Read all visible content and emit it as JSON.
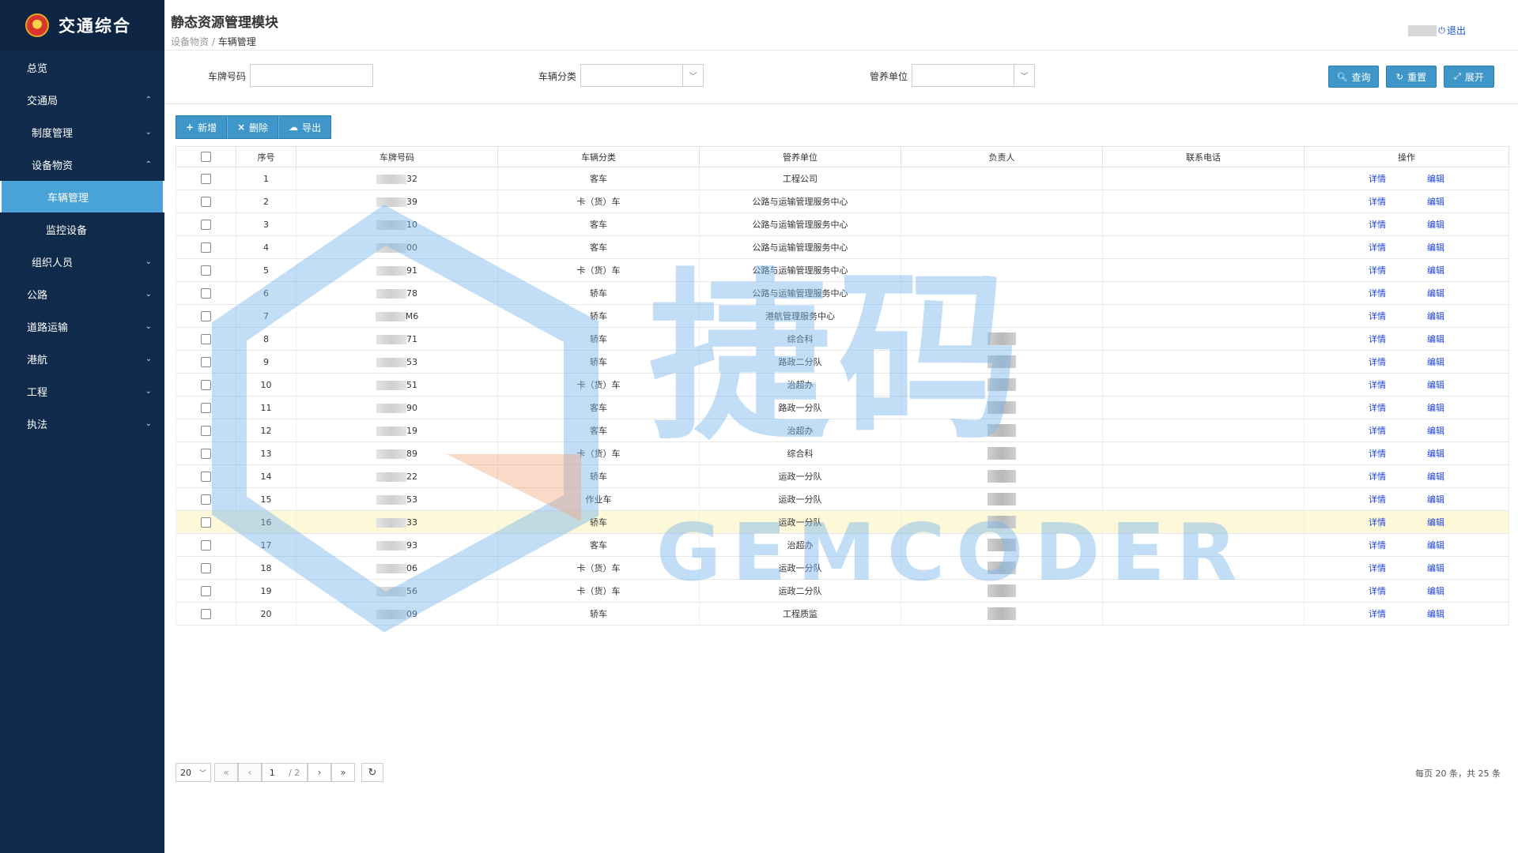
{
  "app": {
    "brand": "交通综合"
  },
  "sidebar": {
    "items": [
      {
        "label": "总览",
        "chevron": ""
      },
      {
        "label": "交通局",
        "chevron": "⌃"
      },
      {
        "label": "制度管理",
        "chevron": "⌄"
      },
      {
        "label": "设备物资",
        "chevron": "⌃"
      },
      {
        "label": "车辆管理",
        "chevron": ""
      },
      {
        "label": "监控设备",
        "chevron": ""
      },
      {
        "label": "组织人员",
        "chevron": "⌄"
      },
      {
        "label": "公路",
        "chevron": "⌄"
      },
      {
        "label": "道路运输",
        "chevron": "⌄"
      },
      {
        "label": "港航",
        "chevron": "⌄"
      },
      {
        "label": "工程",
        "chevron": "⌄"
      },
      {
        "label": "执法",
        "chevron": "⌄"
      }
    ]
  },
  "header": {
    "title": "静态资源管理模块",
    "breadcrumb_parent": "设备物资",
    "breadcrumb_sep": "/",
    "breadcrumb_current": "车辆管理",
    "logout": "退出"
  },
  "filters": {
    "plate_label": "车牌号码",
    "plate_value": "",
    "category_label": "车辆分类",
    "category_value": "",
    "unit_label": "管养单位",
    "unit_value": "",
    "query": "查询",
    "reset": "重置",
    "expand": "展开"
  },
  "toolbar": {
    "add": "新增",
    "delete": "删除",
    "export": "导出"
  },
  "table": {
    "headers": [
      "序号",
      "车牌号码",
      "车辆分类",
      "管养单位",
      "负责人",
      "联系电话",
      "操作"
    ],
    "detail": "详情",
    "edit": "编辑",
    "rows": [
      {
        "no": "1",
        "plate": "32",
        "cat": "客车",
        "unit": "工程公司",
        "person": false
      },
      {
        "no": "2",
        "plate": "39",
        "cat": "卡（货）车",
        "unit": "公路与运输管理服务中心",
        "person": false
      },
      {
        "no": "3",
        "plate": "10",
        "cat": "客车",
        "unit": "公路与运输管理服务中心",
        "person": false
      },
      {
        "no": "4",
        "plate": "00",
        "cat": "客车",
        "unit": "公路与运输管理服务中心",
        "person": false
      },
      {
        "no": "5",
        "plate": "91",
        "cat": "卡（货）车",
        "unit": "公路与运输管理服务中心",
        "person": false
      },
      {
        "no": "6",
        "plate": "78",
        "cat": "轿车",
        "unit": "公路与运输管理服务中心",
        "person": false
      },
      {
        "no": "7",
        "plate": "M6",
        "cat": "轿车",
        "unit": "港航管理服务中心",
        "person": false
      },
      {
        "no": "8",
        "plate": "71",
        "cat": "轿车",
        "unit": "综合科",
        "person": true
      },
      {
        "no": "9",
        "plate": "53",
        "cat": "轿车",
        "unit": "路政二分队",
        "person": true
      },
      {
        "no": "10",
        "plate": "51",
        "cat": "卡（货）车",
        "unit": "治超办",
        "person": true
      },
      {
        "no": "11",
        "plate": "90",
        "cat": "客车",
        "unit": "路政一分队",
        "person": true
      },
      {
        "no": "12",
        "plate": "19",
        "cat": "客车",
        "unit": "治超办",
        "person": true
      },
      {
        "no": "13",
        "plate": "89",
        "cat": "卡（货）车",
        "unit": "综合科",
        "person": true
      },
      {
        "no": "14",
        "plate": "22",
        "cat": "轿车",
        "unit": "运政一分队",
        "person": true
      },
      {
        "no": "15",
        "plate": "53",
        "cat": "作业车",
        "unit": "运政一分队",
        "person": true
      },
      {
        "no": "16",
        "plate": "33",
        "cat": "轿车",
        "unit": "运政一分队",
        "person": true
      },
      {
        "no": "17",
        "plate": "93",
        "cat": "客车",
        "unit": "治超办",
        "person": true
      },
      {
        "no": "18",
        "plate": "06",
        "cat": "卡（货）车",
        "unit": "运政一分队",
        "person": true
      },
      {
        "no": "19",
        "plate": "56",
        "cat": "卡（货）车",
        "unit": "运政二分队",
        "person": true
      },
      {
        "no": "20",
        "plate": "09",
        "cat": "轿车",
        "unit": "工程质监",
        "person": true
      }
    ]
  },
  "pager": {
    "page_size": "20",
    "current": "1",
    "total_pages": "/ 2",
    "info": "每页 20 条，共 25 条"
  },
  "watermark": {
    "main": "捷码",
    "sub": "GEMCODER"
  }
}
